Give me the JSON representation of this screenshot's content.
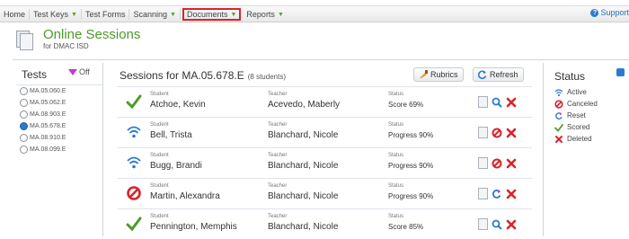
{
  "nav": {
    "items": [
      {
        "label": "Home",
        "caret": false
      },
      {
        "label": "Test Keys",
        "caret": true
      },
      {
        "label": "Test Forms",
        "caret": false
      },
      {
        "label": "Scanning",
        "caret": true
      },
      {
        "label": "Documents",
        "caret": true,
        "highlighted": true
      },
      {
        "label": "Reports",
        "caret": true
      }
    ],
    "support_label": "Support"
  },
  "header": {
    "title": "Online Sessions",
    "subtitle": "for DMAC ISD"
  },
  "tests": {
    "title": "Tests",
    "filter_label": "Off",
    "items": [
      {
        "label": "MA.05.060.E",
        "selected": false
      },
      {
        "label": "MA.05.062.E",
        "selected": false
      },
      {
        "label": "MA.08.903.E",
        "selected": false
      },
      {
        "label": "MA.05.678.E",
        "selected": true
      },
      {
        "label": "MA.08.910.E",
        "selected": false
      },
      {
        "label": "MA.08.099.E",
        "selected": false
      }
    ]
  },
  "sessions": {
    "heading": "Sessions for MA.05.678.E",
    "count_label": "(8 students)",
    "rubrics_label": "Rubrics",
    "refresh_label": "Refresh",
    "col_student": "Student",
    "col_teacher": "Teacher",
    "col_status": "Status",
    "rows": [
      {
        "status_icon": "check-icon",
        "student": "Atchoe, Kevin",
        "teacher": "Acevedo, Maberly",
        "status": "Score 69%",
        "actions": [
          "document-icon",
          "magnifier-icon",
          "delete-x-icon"
        ]
      },
      {
        "status_icon": "wifi-icon",
        "student": "Bell, Trista",
        "teacher": "Blanchard, Nicole",
        "status": "Progress 90%",
        "actions": [
          "document-icon",
          "cancel-icon",
          "delete-x-icon"
        ]
      },
      {
        "status_icon": "wifi-icon",
        "student": "Bugg, Brandi",
        "teacher": "Blanchard, Nicole",
        "status": "Progress 90%",
        "actions": [
          "document-icon",
          "cancel-icon",
          "delete-x-icon"
        ]
      },
      {
        "status_icon": "cancel-icon",
        "student": "Martin, Alexandra",
        "teacher": "Blanchard, Nicole",
        "status": "Progress 90%",
        "actions": [
          "document-icon",
          "reset-icon",
          "delete-x-icon"
        ]
      },
      {
        "status_icon": "check-icon",
        "student": "Pennington, Memphis",
        "teacher": "Blanchard, Nicole",
        "status": "Score 85%",
        "actions": [
          "document-icon",
          "magnifier-icon",
          "delete-x-icon"
        ]
      }
    ]
  },
  "status_legend": {
    "title": "Status",
    "items": [
      {
        "icon": "wifi-icon",
        "label": "Active"
      },
      {
        "icon": "cancel-icon",
        "label": "Canceled"
      },
      {
        "icon": "reset-icon",
        "label": "Reset"
      },
      {
        "icon": "check-icon",
        "label": "Scored"
      },
      {
        "icon": "delete-x-icon",
        "label": "Deleted"
      }
    ]
  },
  "colors": {
    "accent_green": "#4e9a2a",
    "cancel_red": "#d9232a",
    "active_blue": "#2a7bd0",
    "filter_purple": "#c03ad0"
  }
}
